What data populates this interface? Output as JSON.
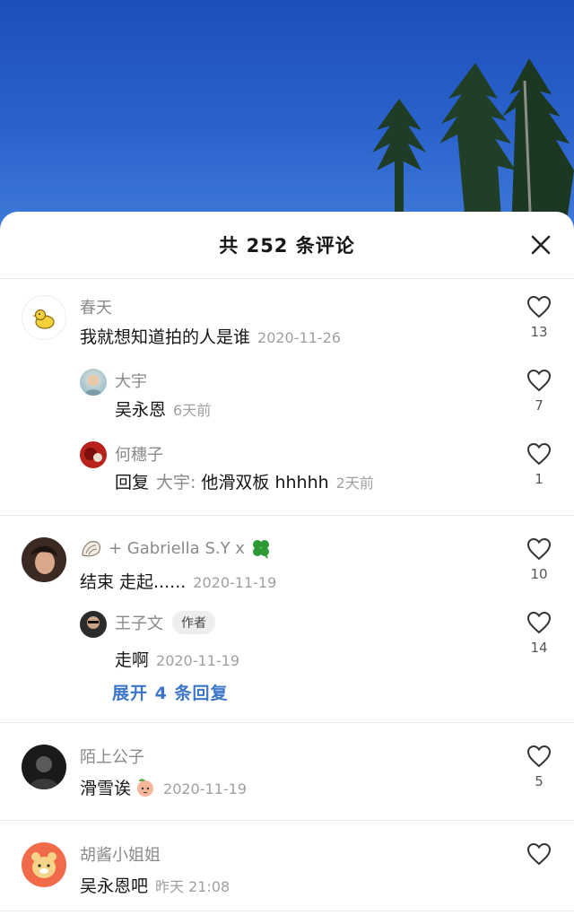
{
  "sheet": {
    "title": "共 252 条评论"
  },
  "threads": [
    {
      "name": "春天",
      "text": "我就想知道拍的人是谁",
      "date": "2020-11-26",
      "likes": "13",
      "replies": [
        {
          "name": "大宇",
          "text": "吴永恩",
          "date": "6天前",
          "likes": "7"
        },
        {
          "name": "何穗子",
          "prefix": "回复",
          "reply_to": "大宇:",
          "text": "他滑双板 hhhhh",
          "date": "2天前",
          "likes": "1"
        }
      ]
    },
    {
      "name": "+ Gabriella S.Y x",
      "text": "结束 走起......",
      "date": "2020-11-19",
      "likes": "10",
      "replies": [
        {
          "name": "王子文",
          "badge": "作者",
          "text": "走啊",
          "date": "2020-11-19",
          "likes": "14"
        }
      ],
      "expand": "展开 4 条回复"
    },
    {
      "name": "陌上公子",
      "text": "滑雪诶",
      "date": "2020-11-19",
      "likes": "5"
    },
    {
      "name": "胡酱小姐姐",
      "text": "吴永恩吧",
      "date": "昨天 21:08",
      "likes": ""
    }
  ]
}
